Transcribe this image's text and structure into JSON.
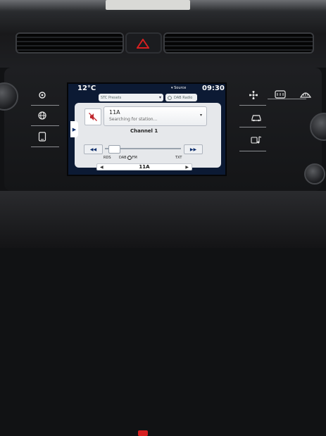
{
  "screen": {
    "temperature": "12°C",
    "source_label": "Source",
    "clock": "09:30",
    "band_select": {
      "label": "STC Presets"
    },
    "dab_radio_button": {
      "label": "DAB Radio"
    },
    "station": {
      "name": "11A",
      "status": "Searching for station..."
    },
    "channel": "Channel 1",
    "options": {
      "rds": "RDS",
      "dab_prefix": "DAB",
      "dab_suffix": "FM",
      "txt": "TXT"
    },
    "frequency": "11A",
    "tune_position": 0.05
  },
  "icons": {
    "left_buttons": [
      "gear-icon",
      "globe-icon",
      "phone-icon"
    ],
    "right_buttons": [
      "fan-icon",
      "car-icon",
      "music-icon"
    ],
    "top_right_buttons": [
      "rear-defrost-icon",
      "front-defrost-icon"
    ]
  },
  "colors": {
    "screen_bg": "#0c1a34",
    "accent": "#0c2d6b",
    "mute_red": "#c0282e",
    "hazard_red": "#d62020"
  }
}
